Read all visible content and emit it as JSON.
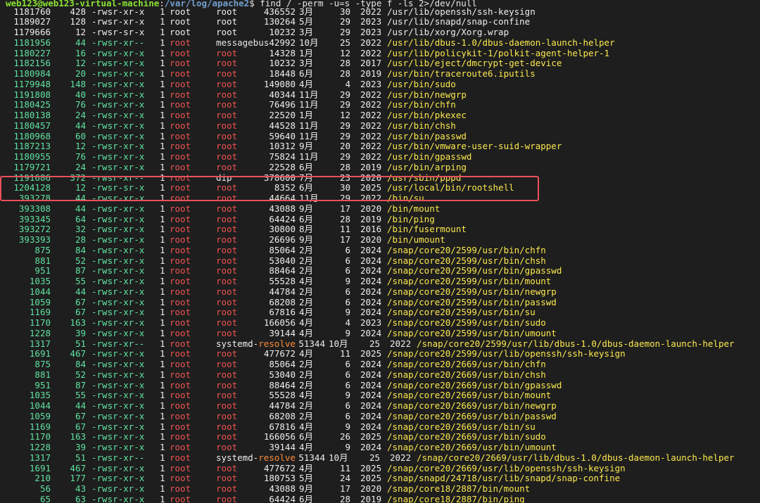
{
  "colors": {
    "prompt_user": "#8ae234",
    "prompt_path": "#729fcf",
    "green": "#5fe3a1",
    "red": "#ef5350",
    "yellow": "#fce94f",
    "orange": "#ff8c3a",
    "highlight": "#e8505b",
    "background": "#1e1e1e"
  },
  "prompt": {
    "user_host": "web123@web123-virtual-machine",
    "sep": ":",
    "path": "/var/log/apache2",
    "cmd": "$ find / -perm -u=s -type f -ls 2>/dev/null"
  },
  "rows": [
    {
      "inode": "1181760",
      "blocks": "428",
      "perms": "-rwsr-xr-x",
      "links": "1",
      "owner": "root",
      "group": "root",
      "size": "436552",
      "month": "3月",
      "day": "30",
      "year": "2022",
      "path": "/usr/lib/openssh/ssh-keysign",
      "style": "white"
    },
    {
      "inode": "1189027",
      "blocks": "128",
      "perms": "-rwsr-xr-x",
      "links": "1",
      "owner": "root",
      "group": "root",
      "size": "130264",
      "month": "5月",
      "day": "29",
      "year": "2023",
      "path": "/usr/lib/snapd/snap-confine",
      "style": "white"
    },
    {
      "inode": "1179666",
      "blocks": "12",
      "perms": "-rwsr-sr-x",
      "links": "1",
      "owner": "root",
      "group": "root",
      "size": "10232",
      "month": "3月",
      "day": "29",
      "year": "2023",
      "path": "/usr/lib/xorg/Xorg.wrap",
      "style": "white"
    },
    {
      "inode": "1181956",
      "blocks": "44",
      "perms": "-rwsr-xr--",
      "links": "1",
      "owner": "root",
      "group": "messagebus",
      "size": "42992",
      "month": "10月",
      "day": "25",
      "year": "2022",
      "path": "/usr/lib/dbus-1.0/dbus-daemon-launch-helper",
      "style": "color"
    },
    {
      "inode": "1180227",
      "blocks": "16",
      "perms": "-rwsr-xr-x",
      "links": "1",
      "owner": "root",
      "group": "root",
      "size": "14328",
      "month": "1月",
      "day": "12",
      "year": "2022",
      "path": "/usr/lib/policykit-1/polkit-agent-helper-1",
      "style": "color"
    },
    {
      "inode": "1182156",
      "blocks": "12",
      "perms": "-rwsr-xr-x",
      "links": "1",
      "owner": "root",
      "group": "root",
      "size": "10232",
      "month": "3月",
      "day": "28",
      "year": "2017",
      "path": "/usr/lib/eject/dmcrypt-get-device",
      "style": "color"
    },
    {
      "inode": "1180984",
      "blocks": "20",
      "perms": "-rwsr-xr-x",
      "links": "1",
      "owner": "root",
      "group": "root",
      "size": "18448",
      "month": "6月",
      "day": "28",
      "year": "2019",
      "path": "/usr/bin/traceroute6.iputils",
      "style": "color"
    },
    {
      "inode": "1179948",
      "blocks": "148",
      "perms": "-rwsr-xr-x",
      "links": "1",
      "owner": "root",
      "group": "root",
      "size": "149080",
      "month": "4月",
      "day": "4",
      "year": "2023",
      "path": "/usr/bin/sudo",
      "style": "color"
    },
    {
      "inode": "1191808",
      "blocks": "40",
      "perms": "-rwsr-xr-x",
      "links": "1",
      "owner": "root",
      "group": "root",
      "size": "40344",
      "month": "11月",
      "day": "29",
      "year": "2022",
      "path": "/usr/bin/newgrp",
      "style": "color"
    },
    {
      "inode": "1180425",
      "blocks": "76",
      "perms": "-rwsr-xr-x",
      "links": "1",
      "owner": "root",
      "group": "root",
      "size": "76496",
      "month": "11月",
      "day": "29",
      "year": "2022",
      "path": "/usr/bin/chfn",
      "style": "color"
    },
    {
      "inode": "1180138",
      "blocks": "24",
      "perms": "-rwsr-xr-x",
      "links": "1",
      "owner": "root",
      "group": "root",
      "size": "22520",
      "month": "1月",
      "day": "12",
      "year": "2022",
      "path": "/usr/bin/pkexec",
      "style": "color"
    },
    {
      "inode": "1180457",
      "blocks": "44",
      "perms": "-rwsr-xr-x",
      "links": "1",
      "owner": "root",
      "group": "root",
      "size": "44528",
      "month": "11月",
      "day": "29",
      "year": "2022",
      "path": "/usr/bin/chsh",
      "style": "color"
    },
    {
      "inode": "1180968",
      "blocks": "60",
      "perms": "-rwsr-xr-x",
      "links": "1",
      "owner": "root",
      "group": "root",
      "size": "59640",
      "month": "11月",
      "day": "29",
      "year": "2022",
      "path": "/usr/bin/passwd",
      "style": "color"
    },
    {
      "inode": "1187213",
      "blocks": "12",
      "perms": "-rwsr-xr-x",
      "links": "1",
      "owner": "root",
      "group": "root",
      "size": "10312",
      "month": "9月",
      "day": "20",
      "year": "2022",
      "path": "/usr/bin/vmware-user-suid-wrapper",
      "style": "color"
    },
    {
      "inode": "1180955",
      "blocks": "76",
      "perms": "-rwsr-xr-x",
      "links": "1",
      "owner": "root",
      "group": "root",
      "size": "75824",
      "month": "11月",
      "day": "29",
      "year": "2022",
      "path": "/usr/bin/gpasswd",
      "style": "color"
    },
    {
      "inode": "1179721",
      "blocks": "24",
      "perms": "-rwsr-xr-x",
      "links": "1",
      "owner": "root",
      "group": "root",
      "size": "22528",
      "month": "6月",
      "day": "28",
      "year": "2019",
      "path": "/usr/bin/arping",
      "style": "color"
    },
    {
      "inode": "1191686",
      "blocks": "372",
      "perms": "-rwsr-xr--",
      "links": "1",
      "owner": "root",
      "group": "dip",
      "size": "378600",
      "month": "7月",
      "day": "23",
      "year": "2020",
      "path": "/usr/sbin/pppd",
      "style": "color"
    },
    {
      "inode": "1204128",
      "blocks": "12",
      "perms": "-rwsr-sr-x",
      "links": "1",
      "owner": "root",
      "group": "root",
      "size": "8352",
      "month": "6月",
      "day": "30",
      "year": "2025",
      "path": "/usr/local/bin/rootshell",
      "style": "color"
    },
    {
      "inode": "393278",
      "blocks": "44",
      "perms": "-rwsr-xr-x",
      "links": "1",
      "owner": "root",
      "group": "root",
      "size": "44664",
      "month": "11月",
      "day": "29",
      "year": "2022",
      "path": "/bin/su",
      "style": "color"
    },
    {
      "inode": "393308",
      "blocks": "44",
      "perms": "-rwsr-xr-x",
      "links": "1",
      "owner": "root",
      "group": "root",
      "size": "43088",
      "month": "9月",
      "day": "17",
      "year": "2020",
      "path": "/bin/mount",
      "style": "color"
    },
    {
      "inode": "393345",
      "blocks": "64",
      "perms": "-rwsr-xr-x",
      "links": "1",
      "owner": "root",
      "group": "root",
      "size": "64424",
      "month": "6月",
      "day": "28",
      "year": "2019",
      "path": "/bin/ping",
      "style": "color"
    },
    {
      "inode": "393272",
      "blocks": "32",
      "perms": "-rwsr-xr-x",
      "links": "1",
      "owner": "root",
      "group": "root",
      "size": "30800",
      "month": "8月",
      "day": "11",
      "year": "2016",
      "path": "/bin/fusermount",
      "style": "color"
    },
    {
      "inode": "393393",
      "blocks": "28",
      "perms": "-rwsr-xr-x",
      "links": "1",
      "owner": "root",
      "group": "root",
      "size": "26696",
      "month": "9月",
      "day": "17",
      "year": "2020",
      "path": "/bin/umount",
      "style": "color"
    },
    {
      "inode": "875",
      "blocks": "84",
      "perms": "-rwsr-xr-x",
      "links": "1",
      "owner": "root",
      "group": "root",
      "size": "85064",
      "month": "2月",
      "day": "6",
      "year": "2024",
      "path": "/snap/core20/2599/usr/bin/chfn",
      "style": "color"
    },
    {
      "inode": "881",
      "blocks": "52",
      "perms": "-rwsr-xr-x",
      "links": "1",
      "owner": "root",
      "group": "root",
      "size": "53040",
      "month": "2月",
      "day": "6",
      "year": "2024",
      "path": "/snap/core20/2599/usr/bin/chsh",
      "style": "color"
    },
    {
      "inode": "951",
      "blocks": "87",
      "perms": "-rwsr-xr-x",
      "links": "1",
      "owner": "root",
      "group": "root",
      "size": "88464",
      "month": "2月",
      "day": "6",
      "year": "2024",
      "path": "/snap/core20/2599/usr/bin/gpasswd",
      "style": "color"
    },
    {
      "inode": "1035",
      "blocks": "55",
      "perms": "-rwsr-xr-x",
      "links": "1",
      "owner": "root",
      "group": "root",
      "size": "55528",
      "month": "4月",
      "day": "9",
      "year": "2024",
      "path": "/snap/core20/2599/usr/bin/mount",
      "style": "color"
    },
    {
      "inode": "1044",
      "blocks": "44",
      "perms": "-rwsr-xr-x",
      "links": "1",
      "owner": "root",
      "group": "root",
      "size": "44784",
      "month": "2月",
      "day": "6",
      "year": "2024",
      "path": "/snap/core20/2599/usr/bin/newgrp",
      "style": "color"
    },
    {
      "inode": "1059",
      "blocks": "67",
      "perms": "-rwsr-xr-x",
      "links": "1",
      "owner": "root",
      "group": "root",
      "size": "68208",
      "month": "2月",
      "day": "6",
      "year": "2024",
      "path": "/snap/core20/2599/usr/bin/passwd",
      "style": "color"
    },
    {
      "inode": "1169",
      "blocks": "67",
      "perms": "-rwsr-xr-x",
      "links": "1",
      "owner": "root",
      "group": "root",
      "size": "67816",
      "month": "4月",
      "day": "9",
      "year": "2024",
      "path": "/snap/core20/2599/usr/bin/su",
      "style": "color"
    },
    {
      "inode": "1170",
      "blocks": "163",
      "perms": "-rwsr-xr-x",
      "links": "1",
      "owner": "root",
      "group": "root",
      "size": "166056",
      "month": "4月",
      "day": "4",
      "year": "2023",
      "path": "/snap/core20/2599/usr/bin/sudo",
      "style": "color"
    },
    {
      "inode": "1228",
      "blocks": "39",
      "perms": "-rwsr-xr-x",
      "links": "1",
      "owner": "root",
      "group": "root",
      "size": "39144",
      "month": "4月",
      "day": "9",
      "year": "2024",
      "path": "/snap/core20/2599/usr/bin/umount",
      "style": "color"
    },
    {
      "inode": "1317",
      "blocks": "51",
      "perms": "-rwsr-xr--",
      "links": "1",
      "owner": "root",
      "group": "systemd-resolve",
      "size": "51344",
      "month": "10月",
      "day": "25",
      "year": "2022",
      "path": "/snap/core20/2599/usr/lib/dbus-1.0/dbus-daemon-launch-helper",
      "style": "color"
    },
    {
      "inode": "1691",
      "blocks": "467",
      "perms": "-rwsr-xr-x",
      "links": "1",
      "owner": "root",
      "group": "root",
      "size": "477672",
      "month": "4月",
      "day": "11",
      "year": "2025",
      "path": "/snap/core20/2599/usr/lib/openssh/ssh-keysign",
      "style": "color"
    },
    {
      "inode": "875",
      "blocks": "84",
      "perms": "-rwsr-xr-x",
      "links": "1",
      "owner": "root",
      "group": "root",
      "size": "85064",
      "month": "2月",
      "day": "6",
      "year": "2024",
      "path": "/snap/core20/2669/usr/bin/chfn",
      "style": "color"
    },
    {
      "inode": "881",
      "blocks": "52",
      "perms": "-rwsr-xr-x",
      "links": "1",
      "owner": "root",
      "group": "root",
      "size": "53040",
      "month": "2月",
      "day": "6",
      "year": "2024",
      "path": "/snap/core20/2669/usr/bin/chsh",
      "style": "color"
    },
    {
      "inode": "951",
      "blocks": "87",
      "perms": "-rwsr-xr-x",
      "links": "1",
      "owner": "root",
      "group": "root",
      "size": "88464",
      "month": "2月",
      "day": "6",
      "year": "2024",
      "path": "/snap/core20/2669/usr/bin/gpasswd",
      "style": "color"
    },
    {
      "inode": "1035",
      "blocks": "55",
      "perms": "-rwsr-xr-x",
      "links": "1",
      "owner": "root",
      "group": "root",
      "size": "55528",
      "month": "4月",
      "day": "9",
      "year": "2024",
      "path": "/snap/core20/2669/usr/bin/mount",
      "style": "color"
    },
    {
      "inode": "1044",
      "blocks": "44",
      "perms": "-rwsr-xr-x",
      "links": "1",
      "owner": "root",
      "group": "root",
      "size": "44784",
      "month": "2月",
      "day": "6",
      "year": "2024",
      "path": "/snap/core20/2669/usr/bin/newgrp",
      "style": "color"
    },
    {
      "inode": "1059",
      "blocks": "67",
      "perms": "-rwsr-xr-x",
      "links": "1",
      "owner": "root",
      "group": "root",
      "size": "68208",
      "month": "2月",
      "day": "6",
      "year": "2024",
      "path": "/snap/core20/2669/usr/bin/passwd",
      "style": "color"
    },
    {
      "inode": "1169",
      "blocks": "67",
      "perms": "-rwsr-xr-x",
      "links": "1",
      "owner": "root",
      "group": "root",
      "size": "67816",
      "month": "4月",
      "day": "9",
      "year": "2024",
      "path": "/snap/core20/2669/usr/bin/su",
      "style": "color"
    },
    {
      "inode": "1170",
      "blocks": "163",
      "perms": "-rwsr-xr-x",
      "links": "1",
      "owner": "root",
      "group": "root",
      "size": "166056",
      "month": "6月",
      "day": "26",
      "year": "2025",
      "path": "/snap/core20/2669/usr/bin/sudo",
      "style": "color"
    },
    {
      "inode": "1228",
      "blocks": "39",
      "perms": "-rwsr-xr-x",
      "links": "1",
      "owner": "root",
      "group": "root",
      "size": "39144",
      "month": "4月",
      "day": "9",
      "year": "2024",
      "path": "/snap/core20/2669/usr/bin/umount",
      "style": "color"
    },
    {
      "inode": "1317",
      "blocks": "51",
      "perms": "-rwsr-xr--",
      "links": "1",
      "owner": "root",
      "group": "systemd-resolve",
      "size": "51344",
      "month": "10月",
      "day": "25",
      "year": "2022",
      "path": "/snap/core20/2669/usr/lib/dbus-1.0/dbus-daemon-launch-helper",
      "style": "color"
    },
    {
      "inode": "1691",
      "blocks": "467",
      "perms": "-rwsr-xr-x",
      "links": "1",
      "owner": "root",
      "group": "root",
      "size": "477672",
      "month": "4月",
      "day": "11",
      "year": "2025",
      "path": "/snap/core20/2669/usr/lib/openssh/ssh-keysign",
      "style": "color"
    },
    {
      "inode": "210",
      "blocks": "177",
      "perms": "-rwsr-xr-x",
      "links": "1",
      "owner": "root",
      "group": "root",
      "size": "180753",
      "month": "5月",
      "day": "24",
      "year": "2025",
      "path": "/snap/snapd/24718/usr/lib/snapd/snap-confine",
      "style": "color"
    },
    {
      "inode": "56",
      "blocks": "43",
      "perms": "-rwsr-xr-x",
      "links": "1",
      "owner": "root",
      "group": "root",
      "size": "43088",
      "month": "9月",
      "day": "17",
      "year": "2020",
      "path": "/snap/core18/2887/bin/mount",
      "style": "color"
    },
    {
      "inode": "65",
      "blocks": "63",
      "perms": "-rwsr-xr-x",
      "links": "1",
      "owner": "root",
      "group": "root",
      "size": "64424",
      "month": "6月",
      "day": "28",
      "year": "2019",
      "path": "/snap/core18/2887/bin/ping",
      "style": "color"
    }
  ]
}
